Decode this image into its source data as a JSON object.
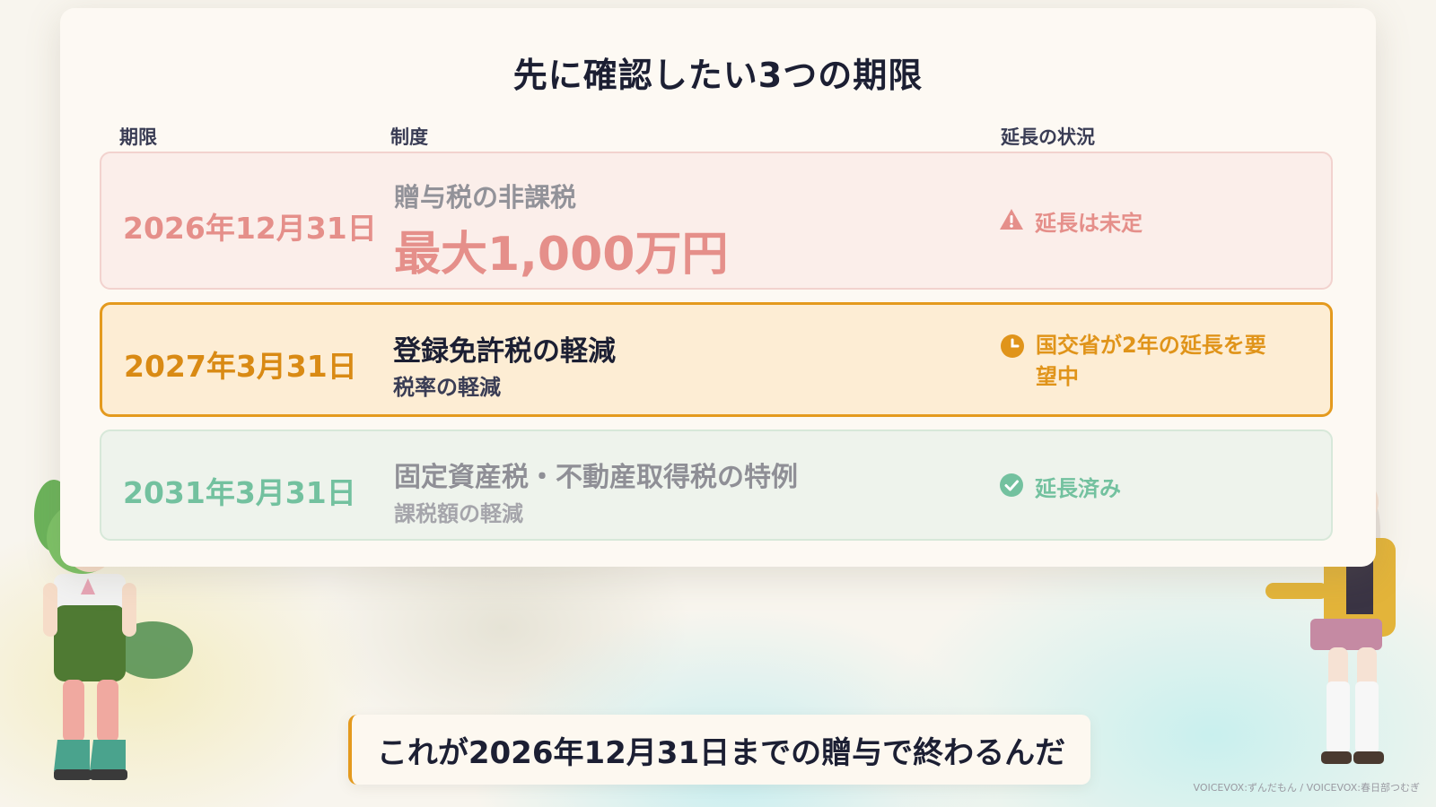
{
  "title": "先に確認したい3つの期限",
  "columns": {
    "deadline": "期限",
    "system": "制度",
    "status": "延長の状況"
  },
  "rows": [
    {
      "date": "2026年12月31日",
      "system": "贈与税の非課税",
      "detail": "最大1,000万円",
      "status": "延長は未定",
      "status_icon": "warning-icon",
      "color": "#e48782"
    },
    {
      "date": "2027年3月31日",
      "system": "登録免許税の軽減",
      "detail": "税率の軽減",
      "status": "国交省が2年の延長を要望中",
      "status_icon": "clock-icon",
      "color": "#e0941a"
    },
    {
      "date": "2031年3月31日",
      "system": "固定資産税・不動産取得税の特例",
      "detail": "課税額の軽減",
      "status": "延長済み",
      "status_icon": "check-circle-icon",
      "color": "#6cbf9b"
    }
  ],
  "subtitle": "これが2026年12月31日までの贈与で終わるんだ",
  "credit": "VOICEVOX:ずんだもん / VOICEVOX:春日部つむぎ"
}
